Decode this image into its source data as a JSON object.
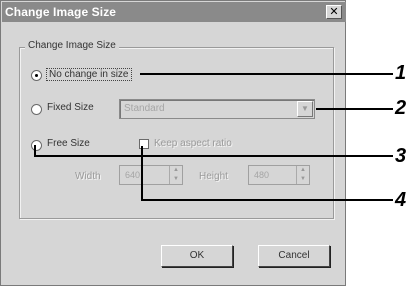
{
  "dialog": {
    "title": "Change Image Size",
    "close_glyph": "✕",
    "group_label": "Change Image Size",
    "options": {
      "no_change": "No change in size",
      "fixed_size": "Fixed Size",
      "fixed_size_value": "Standard",
      "free_size": "Free Size",
      "keep_ratio": "Keep aspect ratio",
      "width_label": "Width",
      "width_value": "640",
      "height_label": "Height",
      "height_value": "480"
    },
    "buttons": {
      "ok": "OK",
      "cancel": "Cancel"
    }
  },
  "callouts": [
    "1",
    "2",
    "3",
    "4"
  ]
}
